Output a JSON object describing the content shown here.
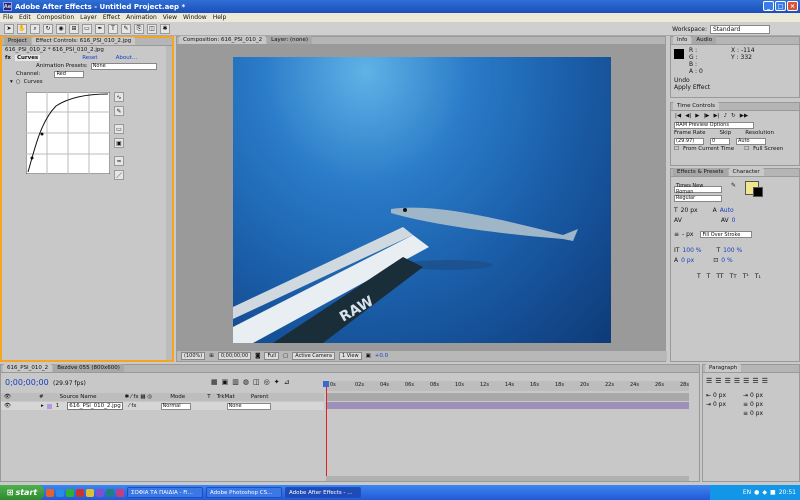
{
  "title": "Adobe After Effects - Untitled Project.aep *",
  "menu": [
    "File",
    "Edit",
    "Composition",
    "Layer",
    "Effect",
    "Animation",
    "View",
    "Window",
    "Help"
  ],
  "workspace": {
    "label": "Workspace:",
    "value": "Standard"
  },
  "project_tab": "Project",
  "effect_controls": {
    "tab": "Effect Controls: 616_PSI_010_2.jpg",
    "path": "616_PSI_010_2 * 616_PSI_010_2.jpg",
    "effect_name": "Curves",
    "reset": "Reset",
    "about": "About...",
    "anim_presets_label": "Animation Presets:",
    "anim_presets_value": "None",
    "channel_label": "Channel:",
    "channel_value": "Red",
    "curves_label": "Curves"
  },
  "composition": {
    "tab": "Composition: 616_PSI_010_2",
    "layer_tab": "Layer: (none)"
  },
  "viewer_footer": {
    "zoom": "(100%)",
    "timecode": "0;00;00;00",
    "resolution": "Full",
    "camera": "Active Camera",
    "views": "1 View",
    "offset": "+0.0"
  },
  "info": {
    "tab": "Info",
    "audio_tab": "Audio",
    "r": "R :",
    "g": "G :",
    "b": "B :",
    "a": "A : 0",
    "x": "X : -114",
    "y": "Y : 332",
    "undo": "Undo",
    "undo_action": "Apply Effect"
  },
  "time_controls": {
    "tab": "Time Controls",
    "ram": "RAM Preview Options",
    "frame_rate_label": "Frame Rate",
    "frame_rate": "(29.97)",
    "skip_label": "Skip",
    "skip": "0",
    "resolution_label": "Resolution",
    "resolution": "Auto",
    "from_current": "From Current Time",
    "full_screen": "Full Screen"
  },
  "character": {
    "effects_tab": "Effects & Presets",
    "tab": "Character",
    "font": "Times New Roman",
    "style": "Regular",
    "size": "20 px",
    "leading": "Auto",
    "tracking": "0",
    "stroke": "- px",
    "stroke_mode": "Fill Over Stroke",
    "vscale": "100 %",
    "hscale": "100 %",
    "baseline": "0 px",
    "tsume": "0 %"
  },
  "timeline": {
    "tab1": "616_PSI_010_2",
    "tab2": "Bezdve 055 (800x600)",
    "timecode": "0;00;00;00",
    "fps": "(29.97 fps)",
    "cols": {
      "source": "Source Name",
      "mode": "Mode",
      "t": "T",
      "trkmat": "TrkMat",
      "parent": "Parent"
    },
    "layer": {
      "num": "1",
      "name": "616_PSI_010_2.jpg",
      "mode": "Normal",
      "parent": "None"
    },
    "ruler": [
      "0s",
      "02s",
      "04s",
      "06s",
      "08s",
      "10s",
      "12s",
      "14s",
      "16s",
      "18s",
      "20s",
      "22s",
      "24s",
      "26s",
      "28s"
    ]
  },
  "paragraph": {
    "tab": "Paragraph",
    "px": "0 px"
  },
  "taskbar": {
    "start": "start",
    "tasks": [
      "ΣΟΦΙΑ ΤΑ ΠΑΙΔΙΑ - Fi...",
      "Adobe Photoshop CS...",
      "Adobe After Effects - ..."
    ],
    "lang": "EN",
    "clock": "20:51"
  },
  "colors": {
    "accent": "#f4a620",
    "title": "#1a4fb8",
    "water": "#1a5da8"
  }
}
